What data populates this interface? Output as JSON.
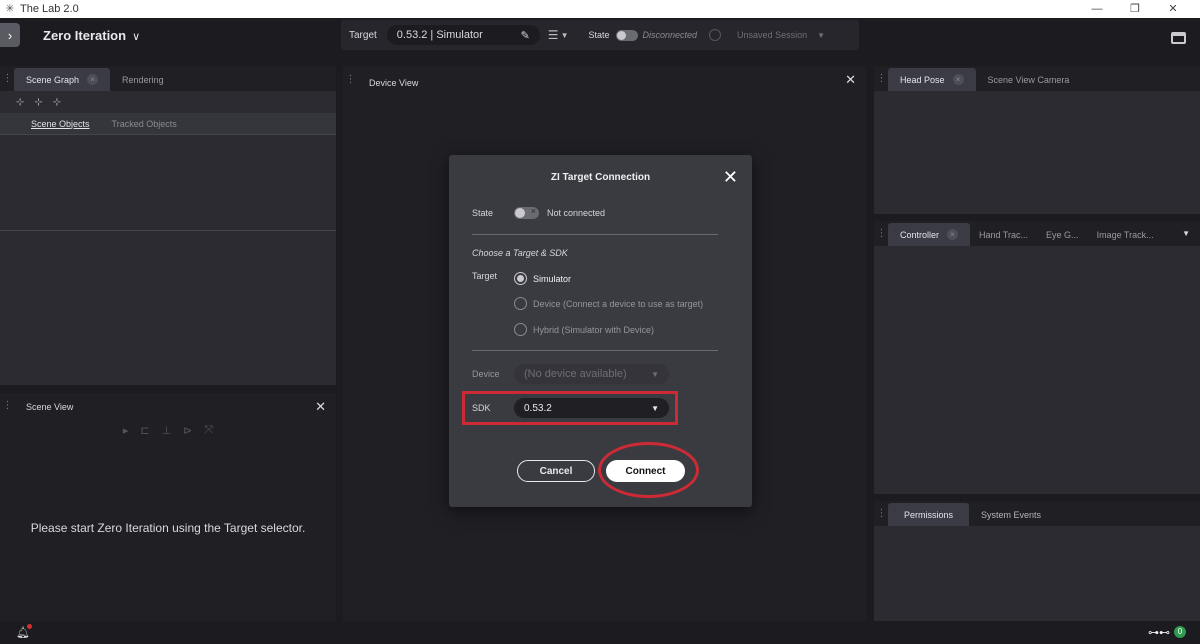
{
  "window": {
    "title": "The Lab 2.0",
    "app_icon": "app-logo-icon",
    "minimize": "—",
    "maximize": "❐",
    "close": "✕"
  },
  "toolbar": {
    "app_title": "Zero Iteration",
    "target_label": "Target",
    "target_value": "0.53.2 | Simulator",
    "state_label": "State",
    "state_value": "Disconnected",
    "session": "Unsaved Session"
  },
  "scene_graph": {
    "tabs": [
      "Scene Graph",
      "Rendering"
    ],
    "sub_tabs": [
      "Scene Objects",
      "Tracked Objects"
    ]
  },
  "scene_view": {
    "title": "Scene View",
    "message": "Please start Zero Iteration using the Target selector."
  },
  "device_view": {
    "title": "Device View"
  },
  "right_panels": {
    "head_pose_tabs": [
      "Head Pose",
      "Scene View Camera"
    ],
    "controller_tabs": [
      "Controller",
      "Hand Trac...",
      "Eye G...",
      "Image Track..."
    ],
    "permissions_tabs": [
      "Permissions",
      "System Events"
    ]
  },
  "modal": {
    "title": "ZI Target Connection",
    "state_label": "State",
    "state_value": "Not connected",
    "section_heading": "Choose a Target & SDK",
    "target_label": "Target",
    "options": [
      "Simulator",
      "Device (Connect a device to use as target)",
      "Hybrid (Simulator with Device)"
    ],
    "selected_option_index": 0,
    "device_label": "Device",
    "device_value": "(No device available)",
    "sdk_label": "SDK",
    "sdk_value": "0.53.2",
    "cancel_label": "Cancel",
    "connect_label": "Connect"
  },
  "status_bar": {
    "badge_count": "0"
  },
  "colors": {
    "annotation_red": "#cc2b35",
    "notification_dot": "#d32f2f",
    "badge_green": "#2e9b4f"
  }
}
